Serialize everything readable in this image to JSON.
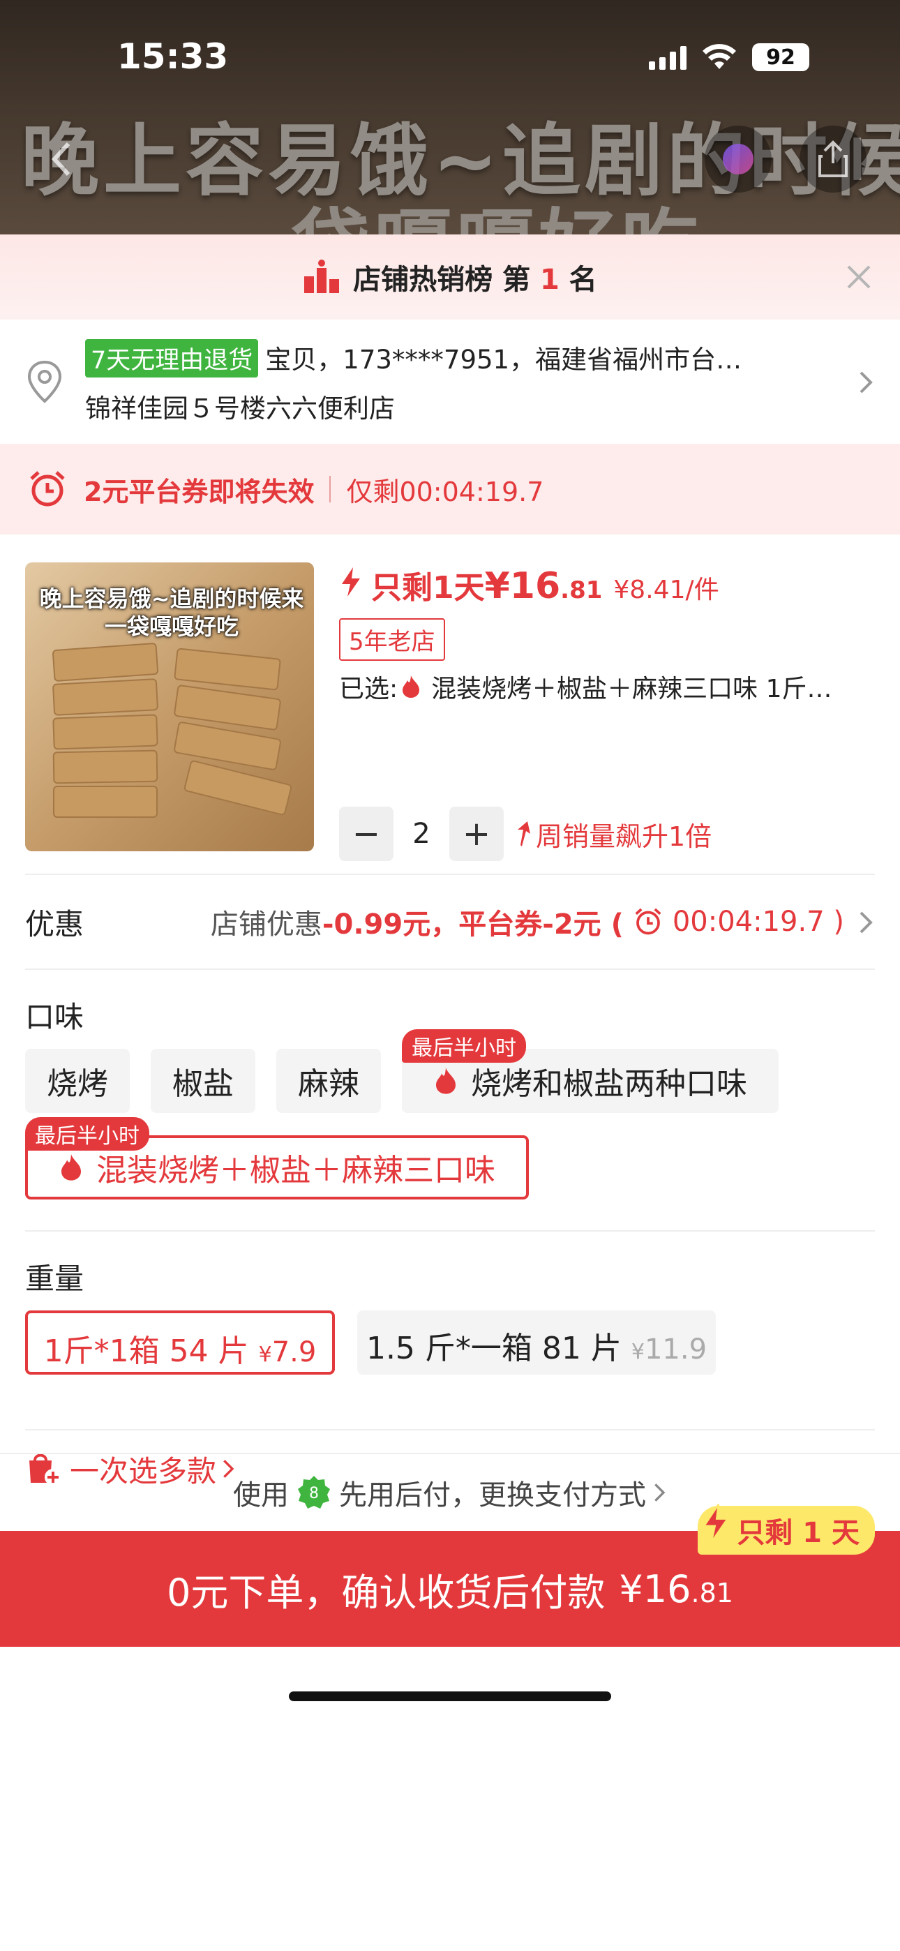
{
  "status_bar": {
    "time": "15:33",
    "battery": "92"
  },
  "background": {
    "title_line1": "晚上容易饿~追剧的时候来",
    "title_line2": "一袋嘎嘎好吃"
  },
  "rank": {
    "prefix": "店铺热销榜 第 ",
    "number": "1",
    "suffix": " 名"
  },
  "address": {
    "return_tag": "7天无理由退货",
    "line1": "宝贝，173****7951，福建省福州市台…",
    "line2": "锦祥佳园５号楼六六便利店"
  },
  "coupon": {
    "text": "2元平台券即将失效",
    "remaining": "仅剩00:04:19.7"
  },
  "product": {
    "image_title_line1": "晚上容易饿~追剧的时候来",
    "image_title_line2": "一袋嘎嘎好吃",
    "flash_label": "只剩1天",
    "price_main": "¥16",
    "price_decimal": ".81",
    "unit_price": "¥8.41/件",
    "shop_tag": "5年老店",
    "selected_prefix": "已选: ",
    "selected_value": "混装烧烤＋椒盐＋麻辣三口味 1斤…",
    "quantity": "2",
    "sales_trend": "周销量飙升1倍"
  },
  "promo": {
    "label": "优惠",
    "shop_discount_label": "店铺优惠",
    "shop_discount_value": "-0.99元",
    "sep": "，",
    "platform_label": "平台券-2元 (",
    "platform_timer": "00:04:19.7 )"
  },
  "flavor": {
    "title": "口味",
    "options": [
      {
        "label": "烧烤"
      },
      {
        "label": "椒盐"
      },
      {
        "label": "麻辣"
      },
      {
        "label": "烧烤和椒盐两种口味",
        "badge": "最后半小时"
      },
      {
        "label": "混装烧烤＋椒盐＋麻辣三口味",
        "badge": "最后半小时",
        "selected": true
      }
    ]
  },
  "weight": {
    "title": "重量",
    "options": [
      {
        "label": "1斤*1箱 54 片",
        "yen": "¥",
        "price": "7.9",
        "selected": true
      },
      {
        "label": "1.5 斤*一箱 81 片",
        "yen": "¥",
        "price": "11.9"
      }
    ]
  },
  "multi_select": {
    "label": "一次选多款"
  },
  "payment": {
    "prefix": "使用",
    "method": "先用后付，更换支付方式",
    "badge_number": "8"
  },
  "order": {
    "label": "0元下单，确认收货后付款",
    "price_main": "¥16",
    "price_decimal": ".81",
    "countdown_tag": "只剩 1 天"
  },
  "colors": {
    "accent": "#e4393c",
    "green": "#3fb53f",
    "badge_yellow": "#fde86a"
  }
}
